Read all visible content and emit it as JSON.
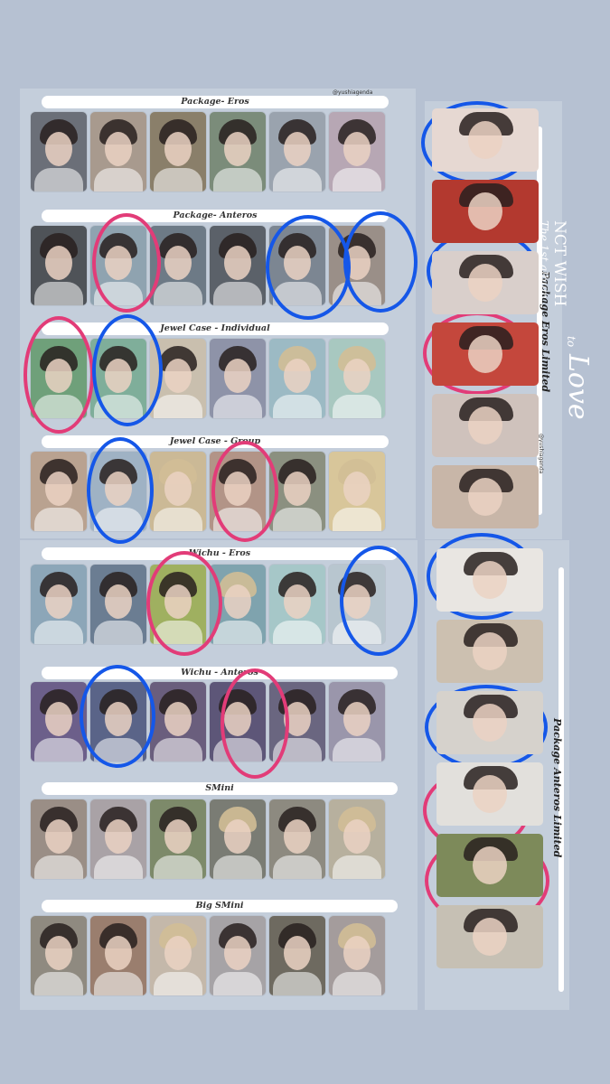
{
  "watermark": "@yushiagenda",
  "watermark_right": "@yushiagenda",
  "album_title": {
    "group": "NCT WISH",
    "subtitle": "The 1st album",
    "to": "to",
    "word": "Love"
  },
  "sections": [
    {
      "label": "Package- Eros",
      "count": 6
    },
    {
      "label": "Package- Anteros",
      "count": 6
    },
    {
      "label": "Jewel Case - Individual",
      "count": 6
    },
    {
      "label": "Jewel Case - Group",
      "count": 6
    },
    {
      "label": "Wichu - Eros",
      "count": 6
    },
    {
      "label": "Wichu - Anteros",
      "count": 6
    },
    {
      "label": "SMini",
      "count": 6
    },
    {
      "label": "Big SMini",
      "count": 6
    }
  ],
  "side_sections": [
    {
      "label": "Package Eros Limited",
      "count": 6
    },
    {
      "label": "Package Anteros Limited",
      "count": 6
    }
  ],
  "colors": {
    "background": "#b6c1d2",
    "ring_blue": "#1557e8",
    "ring_pink": "#e23c78"
  }
}
